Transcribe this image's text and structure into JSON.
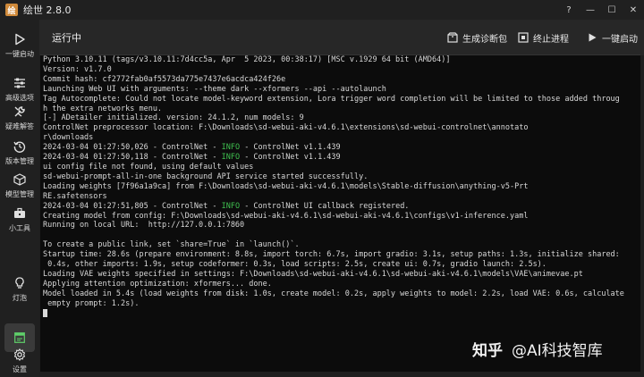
{
  "window": {
    "title": "绘世 2.8.0",
    "logo_text": "绘",
    "controls": {
      "help": "?",
      "minimize": "—",
      "maximize": "☐",
      "close": "✕"
    }
  },
  "sidebar": {
    "items": [
      {
        "label": "一键启动",
        "icon": "play-icon"
      },
      {
        "label": "高级选项",
        "icon": "sliders-icon"
      },
      {
        "label": "疑难解答",
        "icon": "tools-icon"
      },
      {
        "label": "版本管理",
        "icon": "history-icon"
      },
      {
        "label": "模型管理",
        "icon": "cube-icon"
      },
      {
        "label": "小工具",
        "icon": "toolbox-icon"
      },
      {
        "label": "灯泡",
        "icon": "lightbulb-icon"
      },
      {
        "label": "",
        "icon": "console-icon",
        "active": true
      },
      {
        "label": "设置",
        "icon": "gear-icon"
      }
    ]
  },
  "header": {
    "title": "运行中",
    "buttons": [
      {
        "label": "生成诊断包",
        "icon": "package-icon"
      },
      {
        "label": "终止进程",
        "icon": "stop-icon"
      },
      {
        "label": "一键启动",
        "icon": "play-icon"
      }
    ]
  },
  "console": {
    "lines": [
      "Python 3.10.11 (tags/v3.10.11:7d4cc5a, Apr  5 2023, 00:38:17) [MSC v.1929 64 bit (AMD64)]",
      "Version: v1.7.0",
      "Commit hash: cf2772fab0af5573da775e7437e6acdca424f26e",
      "Launching Web UI with arguments: --theme dark --xformers --api --autolaunch",
      "Tag Autocomplete: Could not locate model-keyword extension, Lora trigger word completion will be limited to those added throug",
      "h the extra networks menu.",
      "[-] ADetailer initialized. version: 24.1.2, num models: 9",
      "ControlNet preprocessor location: F:\\Downloads\\sd-webui-aki-v4.6.1\\extensions\\sd-webui-controlnet\\annotato",
      "r\\downloads",
      "2024-03-04 01:27:50,026 - ControlNet - |INFO| - ControlNet v1.1.439",
      "2024-03-04 01:27:50,118 - ControlNet - |INFO| - ControlNet v1.1.439",
      "ui config file not found, using default values",
      "sd-webui-prompt-all-in-one background API service started successfully.",
      "Loading weights [7f96a1a9ca] from F:\\Downloads\\sd-webui-aki-v4.6.1\\models\\Stable-diffusion\\anything-v5-Prt",
      "RE.safetensors",
      "2024-03-04 01:27:51,805 - ControlNet - |INFO| - ControlNet UI callback registered.",
      "Creating model from config: F:\\Downloads\\sd-webui-aki-v4.6.1\\sd-webui-aki-v4.6.1\\configs\\v1-inference.yaml",
      "Running on local URL:  http://127.0.0.1:7860",
      "",
      "To create a public link, set `share=True` in `launch()`.",
      "Startup time: 28.6s (prepare environment: 8.8s, import torch: 6.7s, import gradio: 3.1s, setup paths: 1.3s, initialize shared:",
      " 0.4s, other imports: 1.9s, setup codeformer: 0.3s, load scripts: 2.5s, create ui: 0.7s, gradio launch: 2.5s).",
      "Loading VAE weights specified in settings: F:\\Downloads\\sd-webui-aki-v4.6.1\\sd-webui-aki-v4.6.1\\models\\VAE\\animevae.pt",
      "Applying attention optimization: xformers... done.",
      "Model loaded in 5.4s (load weights from disk: 1.0s, create model: 0.2s, apply weights to model: 2.2s, load VAE: 0.6s, calculate",
      " empty prompt: 1.2s)."
    ]
  },
  "watermark": {
    "logo": "知乎",
    "text": "@AI科技智库"
  },
  "colors": {
    "info": "#3fbf4f",
    "background": "#0c0c0c",
    "sidebar": "#202020"
  }
}
